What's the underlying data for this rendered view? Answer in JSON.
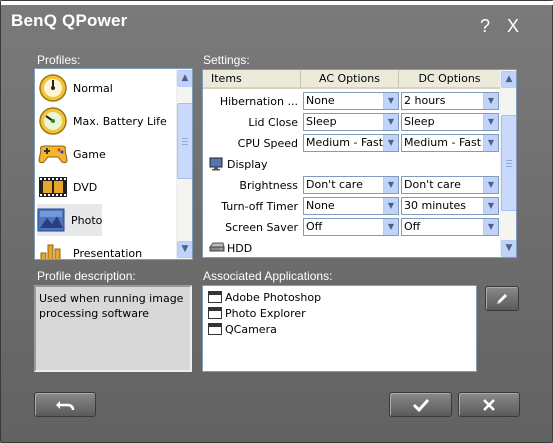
{
  "window": {
    "title": "BenQ QPower",
    "help_label": "?",
    "close_label": "X"
  },
  "profiles": {
    "label": "Profiles:",
    "items": [
      {
        "label": "Normal",
        "icon": "gauge-icon"
      },
      {
        "label": "Max. Battery Life",
        "icon": "gauge-green-icon"
      },
      {
        "label": "Game",
        "icon": "gamepad-icon"
      },
      {
        "label": "DVD",
        "icon": "film-icon"
      },
      {
        "label": "Photo",
        "icon": "photo-icon",
        "selected": true
      },
      {
        "label": "Presentation",
        "icon": "bar-chart-icon"
      }
    ]
  },
  "settings": {
    "label": "Settings:",
    "columns": [
      "Items",
      "AC Options",
      "DC Options"
    ],
    "rows": [
      {
        "type": "item",
        "name": "Hibernation ...",
        "ac": "None",
        "dc": "2 hours"
      },
      {
        "type": "item",
        "name": "Lid Close",
        "ac": "Sleep",
        "dc": "Sleep"
      },
      {
        "type": "item",
        "name": "CPU Speed",
        "ac": "Medium - Fast",
        "dc": "Medium - Fast"
      },
      {
        "type": "group",
        "name": "Display",
        "icon": "monitor-icon"
      },
      {
        "type": "item",
        "name": "Brightness",
        "ac": "Don't care",
        "dc": "Don't care"
      },
      {
        "type": "item",
        "name": "Turn-off Timer",
        "ac": "None",
        "dc": "30 minutes"
      },
      {
        "type": "item",
        "name": "Screen Saver",
        "ac": "Off",
        "dc": "Off"
      },
      {
        "type": "group",
        "name": "HDD",
        "icon": "hdd-icon"
      }
    ]
  },
  "description": {
    "label": "Profile description:",
    "text": "Used when running image processing software"
  },
  "applications": {
    "label": "Associated Applications:",
    "items": [
      "Adobe Photoshop",
      "Photo Explorer",
      "QCamera"
    ]
  },
  "colors": {
    "window_bg": "#6e6e6e",
    "list_border": "#7f9db9",
    "scroll_button": "#c1d3fb"
  }
}
